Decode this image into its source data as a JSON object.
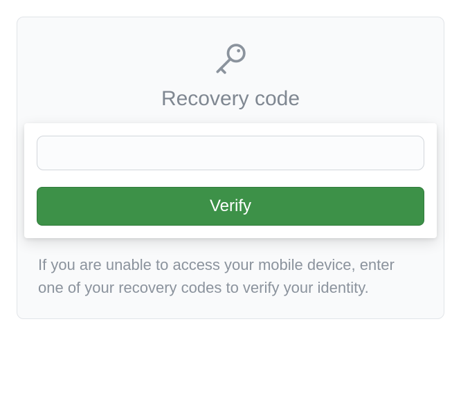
{
  "card": {
    "title": "Recovery code",
    "input_value": "",
    "verify_label": "Verify",
    "help_text": "If you are unable to access your mobile device, enter one of your recovery codes to verify your identity."
  }
}
